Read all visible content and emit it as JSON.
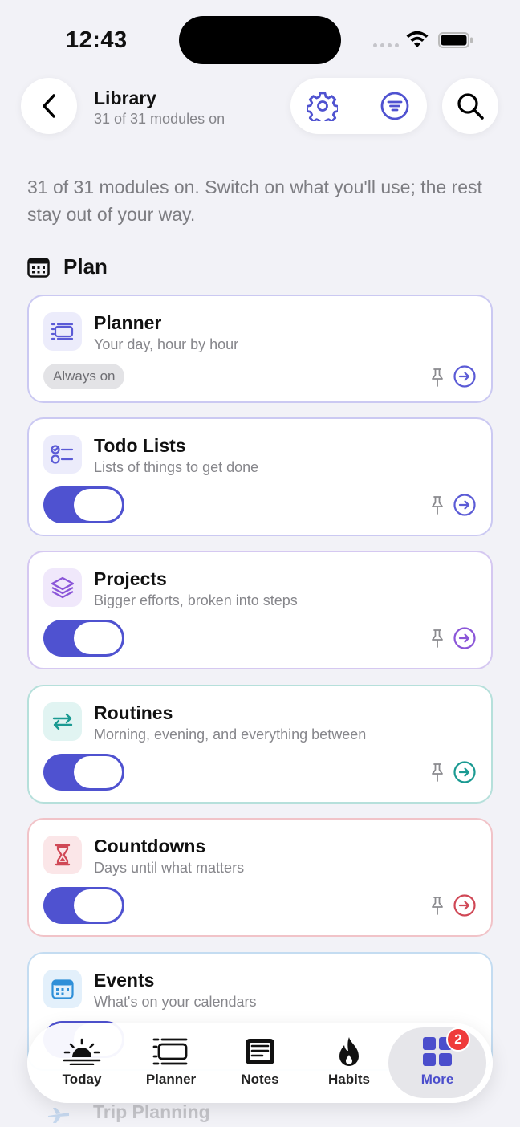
{
  "status": {
    "time": "12:43"
  },
  "header": {
    "title": "Library",
    "subtitle": "31 of 31 modules on"
  },
  "intro": "31 of 31 modules on. Switch on what you'll use; the rest stay out of your way.",
  "section": {
    "label": "Plan",
    "icon": "calendar-icon"
  },
  "modules": [
    {
      "name": "Planner",
      "desc": "Your day, hour by hour",
      "badge": "Always on",
      "icon": "planner-icon",
      "accent": "#5b5bd6",
      "tint": "#ececfb",
      "border": "#cbc9f2"
    },
    {
      "name": "Todo Lists",
      "desc": "Lists of things to get done",
      "enabled": true,
      "icon": "checklist-icon",
      "accent": "#5b5bd6",
      "tint": "#ececfb",
      "border": "#cbc9f2"
    },
    {
      "name": "Projects",
      "desc": "Bigger efforts, broken into steps",
      "enabled": true,
      "icon": "layers-icon",
      "accent": "#8a55d8",
      "tint": "#f0e8fb",
      "border": "#d5c8f1"
    },
    {
      "name": "Routines",
      "desc": "Morning, evening, and everything between",
      "enabled": true,
      "icon": "repeat-icon",
      "accent": "#1a9a92",
      "tint": "#e1f4f2",
      "border": "#b6e0db"
    },
    {
      "name": "Countdowns",
      "desc": "Days until what matters",
      "enabled": true,
      "icon": "hourglass-icon",
      "accent": "#d04856",
      "tint": "#fbe6e8",
      "border": "#f1c3c8"
    },
    {
      "name": "Events",
      "desc": "What's on your calendars",
      "enabled": true,
      "icon": "calendar-icon",
      "accent": "#2f8fd8",
      "tint": "#e3f0fb",
      "border": "#c4dcf1"
    }
  ],
  "next_module": {
    "name": "Trip Planning",
    "icon": "plane-icon"
  },
  "tabs": [
    {
      "label": "Today",
      "icon": "sunrise-icon"
    },
    {
      "label": "Planner",
      "icon": "planner-icon"
    },
    {
      "label": "Notes",
      "icon": "notes-icon"
    },
    {
      "label": "Habits",
      "icon": "flame-icon"
    },
    {
      "label": "More",
      "icon": "grid-icon",
      "active": true,
      "badge": "2"
    }
  ],
  "colors": {
    "accent": "#4f52d0",
    "badge": "#ef3b3b"
  }
}
